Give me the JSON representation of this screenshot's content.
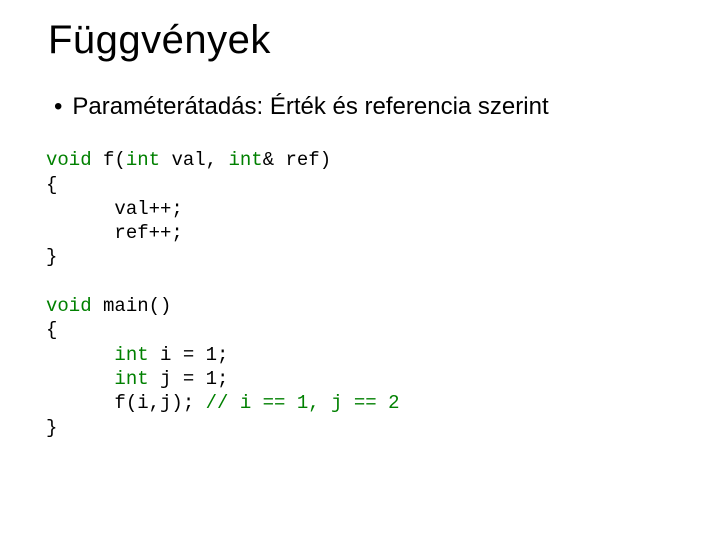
{
  "title": "Függvények",
  "bullet": "Paraméterátadás: Érték és referencia szerint",
  "code": {
    "l1a": "void",
    "l1b": " f(",
    "l1c": "int",
    "l1d": " val, ",
    "l1e": "int",
    "l1f": "& ref)",
    "l2": "{",
    "l3": "      val++;",
    "l4": "      ref++;",
    "l5": "}",
    "blank1": "",
    "l6a": "void",
    "l6b": " main()",
    "l7": "{",
    "l8a": "      ",
    "l8b": "int",
    "l8c": " i = 1;",
    "l9a": "      ",
    "l9b": "int",
    "l9c": " j = 1;",
    "l10a": "      f(i,j); ",
    "l10b": "// i == 1, j == 2",
    "l11": "}"
  }
}
